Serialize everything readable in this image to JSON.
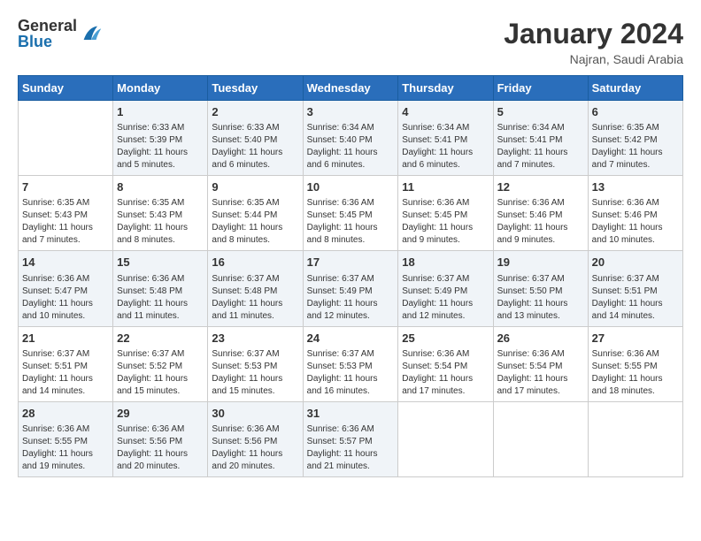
{
  "header": {
    "logo_general": "General",
    "logo_blue": "Blue",
    "month_year": "January 2024",
    "location": "Najran, Saudi Arabia"
  },
  "days_of_week": [
    "Sunday",
    "Monday",
    "Tuesday",
    "Wednesday",
    "Thursday",
    "Friday",
    "Saturday"
  ],
  "weeks": [
    [
      {
        "day": "",
        "info": ""
      },
      {
        "day": "1",
        "info": "Sunrise: 6:33 AM\nSunset: 5:39 PM\nDaylight: 11 hours\nand 5 minutes."
      },
      {
        "day": "2",
        "info": "Sunrise: 6:33 AM\nSunset: 5:40 PM\nDaylight: 11 hours\nand 6 minutes."
      },
      {
        "day": "3",
        "info": "Sunrise: 6:34 AM\nSunset: 5:40 PM\nDaylight: 11 hours\nand 6 minutes."
      },
      {
        "day": "4",
        "info": "Sunrise: 6:34 AM\nSunset: 5:41 PM\nDaylight: 11 hours\nand 6 minutes."
      },
      {
        "day": "5",
        "info": "Sunrise: 6:34 AM\nSunset: 5:41 PM\nDaylight: 11 hours\nand 7 minutes."
      },
      {
        "day": "6",
        "info": "Sunrise: 6:35 AM\nSunset: 5:42 PM\nDaylight: 11 hours\nand 7 minutes."
      }
    ],
    [
      {
        "day": "7",
        "info": "Sunrise: 6:35 AM\nSunset: 5:43 PM\nDaylight: 11 hours\nand 7 minutes."
      },
      {
        "day": "8",
        "info": "Sunrise: 6:35 AM\nSunset: 5:43 PM\nDaylight: 11 hours\nand 8 minutes."
      },
      {
        "day": "9",
        "info": "Sunrise: 6:35 AM\nSunset: 5:44 PM\nDaylight: 11 hours\nand 8 minutes."
      },
      {
        "day": "10",
        "info": "Sunrise: 6:36 AM\nSunset: 5:45 PM\nDaylight: 11 hours\nand 8 minutes."
      },
      {
        "day": "11",
        "info": "Sunrise: 6:36 AM\nSunset: 5:45 PM\nDaylight: 11 hours\nand 9 minutes."
      },
      {
        "day": "12",
        "info": "Sunrise: 6:36 AM\nSunset: 5:46 PM\nDaylight: 11 hours\nand 9 minutes."
      },
      {
        "day": "13",
        "info": "Sunrise: 6:36 AM\nSunset: 5:46 PM\nDaylight: 11 hours\nand 10 minutes."
      }
    ],
    [
      {
        "day": "14",
        "info": "Sunrise: 6:36 AM\nSunset: 5:47 PM\nDaylight: 11 hours\nand 10 minutes."
      },
      {
        "day": "15",
        "info": "Sunrise: 6:36 AM\nSunset: 5:48 PM\nDaylight: 11 hours\nand 11 minutes."
      },
      {
        "day": "16",
        "info": "Sunrise: 6:37 AM\nSunset: 5:48 PM\nDaylight: 11 hours\nand 11 minutes."
      },
      {
        "day": "17",
        "info": "Sunrise: 6:37 AM\nSunset: 5:49 PM\nDaylight: 11 hours\nand 12 minutes."
      },
      {
        "day": "18",
        "info": "Sunrise: 6:37 AM\nSunset: 5:49 PM\nDaylight: 11 hours\nand 12 minutes."
      },
      {
        "day": "19",
        "info": "Sunrise: 6:37 AM\nSunset: 5:50 PM\nDaylight: 11 hours\nand 13 minutes."
      },
      {
        "day": "20",
        "info": "Sunrise: 6:37 AM\nSunset: 5:51 PM\nDaylight: 11 hours\nand 14 minutes."
      }
    ],
    [
      {
        "day": "21",
        "info": "Sunrise: 6:37 AM\nSunset: 5:51 PM\nDaylight: 11 hours\nand 14 minutes."
      },
      {
        "day": "22",
        "info": "Sunrise: 6:37 AM\nSunset: 5:52 PM\nDaylight: 11 hours\nand 15 minutes."
      },
      {
        "day": "23",
        "info": "Sunrise: 6:37 AM\nSunset: 5:53 PM\nDaylight: 11 hours\nand 15 minutes."
      },
      {
        "day": "24",
        "info": "Sunrise: 6:37 AM\nSunset: 5:53 PM\nDaylight: 11 hours\nand 16 minutes."
      },
      {
        "day": "25",
        "info": "Sunrise: 6:36 AM\nSunset: 5:54 PM\nDaylight: 11 hours\nand 17 minutes."
      },
      {
        "day": "26",
        "info": "Sunrise: 6:36 AM\nSunset: 5:54 PM\nDaylight: 11 hours\nand 17 minutes."
      },
      {
        "day": "27",
        "info": "Sunrise: 6:36 AM\nSunset: 5:55 PM\nDaylight: 11 hours\nand 18 minutes."
      }
    ],
    [
      {
        "day": "28",
        "info": "Sunrise: 6:36 AM\nSunset: 5:55 PM\nDaylight: 11 hours\nand 19 minutes."
      },
      {
        "day": "29",
        "info": "Sunrise: 6:36 AM\nSunset: 5:56 PM\nDaylight: 11 hours\nand 20 minutes."
      },
      {
        "day": "30",
        "info": "Sunrise: 6:36 AM\nSunset: 5:56 PM\nDaylight: 11 hours\nand 20 minutes."
      },
      {
        "day": "31",
        "info": "Sunrise: 6:36 AM\nSunset: 5:57 PM\nDaylight: 11 hours\nand 21 minutes."
      },
      {
        "day": "",
        "info": ""
      },
      {
        "day": "",
        "info": ""
      },
      {
        "day": "",
        "info": ""
      }
    ]
  ]
}
